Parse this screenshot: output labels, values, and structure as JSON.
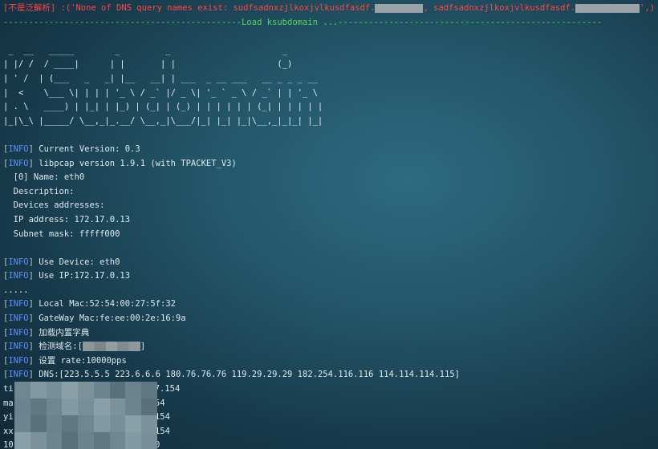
{
  "header": {
    "bracket_open": "[",
    "tag": "不是泛解析",
    "bracket_close": "]",
    "message_start": " :('None of DNS query names exist: ",
    "domain_one": "sudfsadnxzjlkoxjvlkusdfasdf.",
    "separator": ", ",
    "domain_two": "sadfsadnxzjlkoxjvlkusdfasdf.",
    "message_end": "',)"
  },
  "divider": "-----------------------------------------------Load ksubdomain ...----------------------------------------------------",
  "banner": [
    " _  __   _____        _         _                      _",
    "| |/ /  / ____|      | |       | |                    (_)",
    "| ' /  | (___   _   _| |__   __| | ___  _ __ ___   __ _ _ _ __",
    "|  <    \\___ \\| | | | '_ \\ / _` |/ _ \\| '_ ` _ \\ / _` | | '_ \\",
    "| . \\   ____) | |_| | |_) | (_| | (_) | | | | | | (_| | | | | |",
    "|_|\\_\\ |_____/ \\__,_|_.__/ \\__,_|\\___/|_| |_| |_|\\__,_|_|_| |_|"
  ],
  "info_tag": "INFO",
  "log_top": [
    {
      "tag": true,
      "text": " Current Version: 0.3"
    },
    {
      "tag": true,
      "text": " libpcap version 1.9.1 (with TPACKET_V3)"
    },
    {
      "tag": false,
      "text": "  [0] Name: eth0"
    },
    {
      "tag": false,
      "text": "  Description:"
    },
    {
      "tag": false,
      "text": "  Devices addresses:"
    },
    {
      "tag": false,
      "text": "  IP address: 172.17.0.13"
    },
    {
      "tag": false,
      "text": "  Subnet mask: fffff000"
    },
    {
      "tag": false,
      "text": ""
    },
    {
      "tag": true,
      "text": " Use Device: eth0"
    },
    {
      "tag": true,
      "text": " Use IP:172.17.0.13"
    },
    {
      "tag": false,
      "text": "....."
    },
    {
      "tag": true,
      "text": " Local Mac:52:54:00:27:5f:32"
    },
    {
      "tag": true,
      "text": " GateWay Mac:fe:ee:00:2e:16:9a"
    },
    {
      "tag": true,
      "text": " 加载内置字典"
    }
  ],
  "detect_line": {
    "prefix": " 检测域名:[",
    "suffix": "]"
  },
  "rate_line": " 设置 rate:10000pps",
  "dns_line": " DNS:[223.5.5.5 223.6.6.6 180.76.76.76 119.29.29.29 182.254.116.116 114.114.114.115]",
  "results": [
    {
      "head": "ti",
      "tail": "7.154"
    },
    {
      "head": "ma",
      "tail": "154"
    },
    {
      "head": "yi",
      "tail": ".154"
    },
    {
      "head": "xx",
      "tail": ".154"
    },
    {
      "head": "10",
      "tail": "40"
    }
  ]
}
